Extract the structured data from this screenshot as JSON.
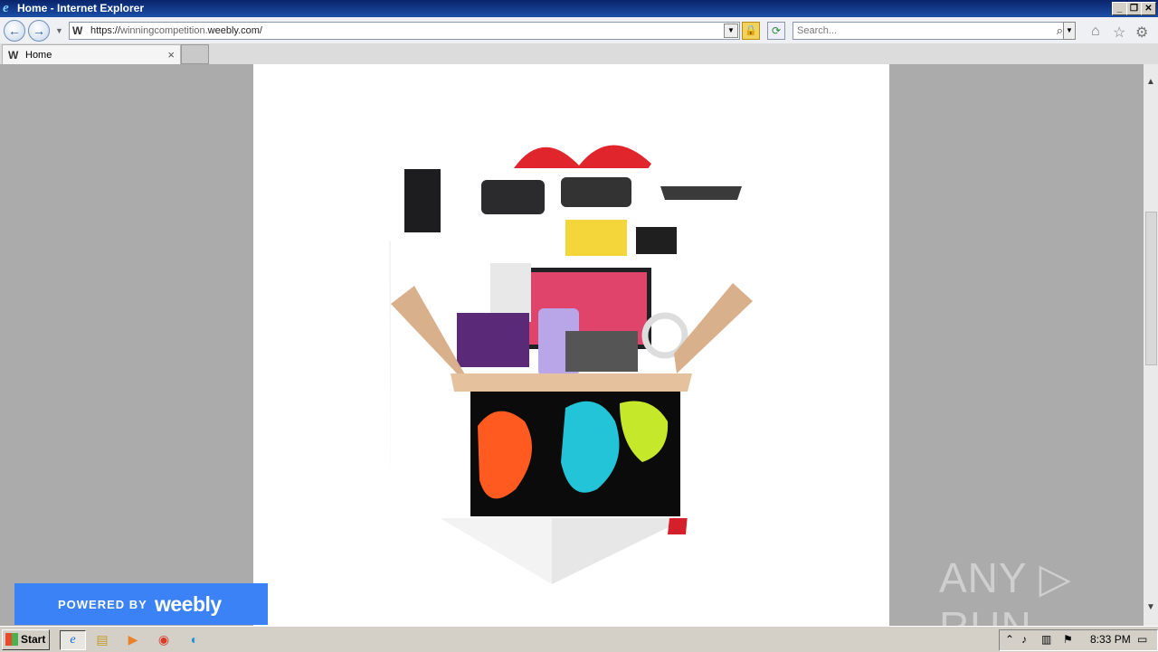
{
  "window": {
    "title": "Home - Internet Explorer"
  },
  "nav": {
    "url_prefix": "https://",
    "url_host_dim": "winningcompetition.",
    "url_host": "weebly.com/",
    "search_placeholder": "Search..."
  },
  "tabs": [
    {
      "label": "Home"
    }
  ],
  "page": {
    "badge": {
      "powered": "POWERED BY",
      "brand": "weebly"
    }
  },
  "watermark": "ANY ▷ RUN",
  "taskbar": {
    "start": "Start",
    "clock": "8:33 PM"
  },
  "colors": {
    "badge": "#3b82f6",
    "titlebar": "#0a246a"
  },
  "icons": [
    "ie-icon",
    "back-icon",
    "forward-icon",
    "lock-icon",
    "refresh-icon",
    "search-icon",
    "home-icon",
    "star-icon",
    "gear-icon",
    "weebly-favicon",
    "close-icon"
  ]
}
